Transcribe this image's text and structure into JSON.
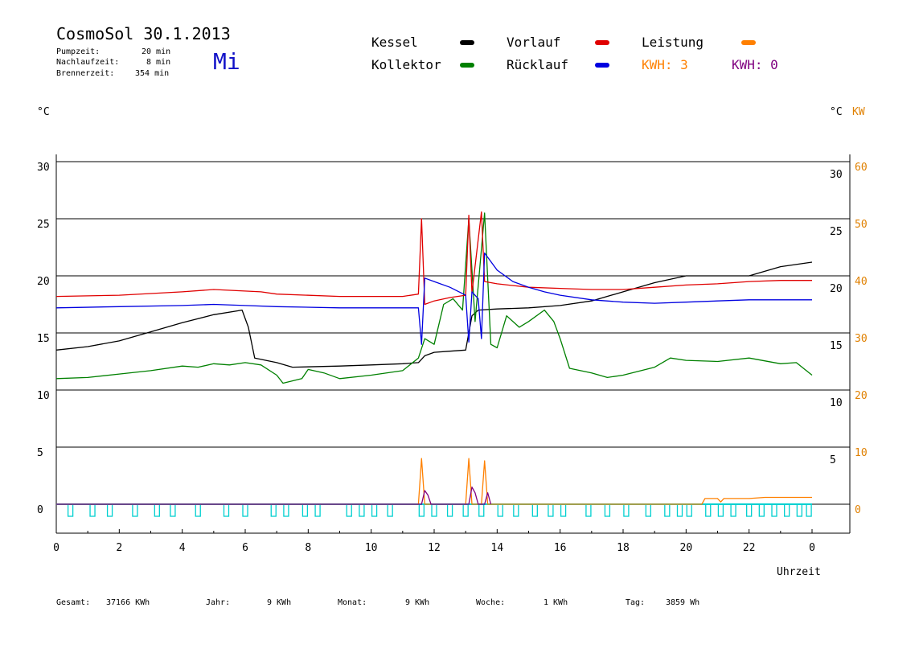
{
  "header": {
    "title": "CosmoSol 30.1.2013",
    "day": "Mi",
    "pumpzeit_label": "Pumpzeit:",
    "pumpzeit_value": "20 min",
    "nachlaufzeit_label": "Nachlaufzeit:",
    "nachlaufzeit_value": "8 min",
    "brennerzeit_label": "Brennerzeit:",
    "brennerzeit_value": "354 min"
  },
  "legend": {
    "kessel": "Kessel",
    "kollektor": "Kollektor",
    "vorlauf": "Vorlauf",
    "ruecklauf": "Rücklauf",
    "leistung": "Leistung",
    "kwh1": "KWH: 3",
    "kwh2": "KWH: 0",
    "colors": {
      "kessel": "#000000",
      "kollektor": "#008000",
      "vorlauf": "#e00000",
      "ruecklauf": "#0000e0",
      "leistung": "#ff8000",
      "kwh2": "#800080",
      "pulse": "#00d0d0"
    }
  },
  "footer": {
    "gesamt_label": "Gesamt:",
    "gesamt_value": "37166 KWh",
    "jahr_label": "Jahr:",
    "jahr_value": "9 KWh",
    "monat_label": "Monat:",
    "monat_value": "9 KWh",
    "woche_label": "Woche:",
    "woche_value": "1 KWh",
    "tag_label": "Tag:",
    "tag_value": "3859 Wh"
  },
  "chart_data": {
    "type": "line",
    "xlabel": "Uhrzeit",
    "ylabel_left": "°C",
    "ylabel_right": "°C",
    "ylabel_right2": "KW",
    "xlim": [
      0,
      24
    ],
    "ylim": [
      -2.5,
      32
    ],
    "x_ticks": [
      "0",
      "2",
      "4",
      "6",
      "8",
      "10",
      "12",
      "14",
      "16",
      "18",
      "20",
      "22",
      "0"
    ],
    "y_ticks_left": [
      "0",
      "5",
      "10",
      "15",
      "20",
      "25",
      "30"
    ],
    "y_ticks_right": [
      "5",
      "10",
      "15",
      "20",
      "25",
      "30"
    ],
    "y_ticks_kw": [
      "0",
      "10",
      "20",
      "30",
      "40",
      "50",
      "60"
    ],
    "grid": true,
    "series": [
      {
        "name": "Kessel",
        "color": "#000000",
        "points": [
          [
            0,
            13.5
          ],
          [
            1,
            13.8
          ],
          [
            2,
            14.3
          ],
          [
            3,
            15.1
          ],
          [
            4,
            15.9
          ],
          [
            5,
            16.6
          ],
          [
            5.9,
            17.0
          ],
          [
            6.1,
            15.5
          ],
          [
            6.3,
            12.8
          ],
          [
            7,
            12.4
          ],
          [
            7.5,
            12.0
          ],
          [
            9,
            12.1
          ],
          [
            10,
            12.2
          ],
          [
            11,
            12.3
          ],
          [
            11.5,
            12.4
          ],
          [
            11.7,
            13.0
          ],
          [
            12,
            13.3
          ],
          [
            12.5,
            13.4
          ],
          [
            13.0,
            13.5
          ],
          [
            13.2,
            16.5
          ],
          [
            13.4,
            17.0
          ],
          [
            14,
            17.1
          ],
          [
            15,
            17.2
          ],
          [
            16,
            17.4
          ],
          [
            17,
            17.8
          ],
          [
            18,
            18.6
          ],
          [
            19,
            19.4
          ],
          [
            20,
            20.0
          ],
          [
            21,
            20.0
          ],
          [
            22,
            20.0
          ],
          [
            23,
            20.8
          ],
          [
            24,
            21.2
          ]
        ]
      },
      {
        "name": "Kollektor",
        "color": "#008000",
        "points": [
          [
            0,
            11.0
          ],
          [
            1,
            11.1
          ],
          [
            2,
            11.4
          ],
          [
            3,
            11.7
          ],
          [
            4,
            12.1
          ],
          [
            4.5,
            12.0
          ],
          [
            5,
            12.3
          ],
          [
            5.5,
            12.2
          ],
          [
            6,
            12.4
          ],
          [
            6.5,
            12.2
          ],
          [
            7,
            11.3
          ],
          [
            7.2,
            10.6
          ],
          [
            7.8,
            11.0
          ],
          [
            8,
            11.8
          ],
          [
            8.5,
            11.5
          ],
          [
            9,
            11.0
          ],
          [
            10,
            11.3
          ],
          [
            11,
            11.7
          ],
          [
            11.5,
            12.8
          ],
          [
            11.7,
            14.5
          ],
          [
            12,
            14.0
          ],
          [
            12.3,
            17.5
          ],
          [
            12.6,
            18.0
          ],
          [
            12.9,
            17.0
          ],
          [
            13.1,
            25.0
          ],
          [
            13.3,
            16.0
          ],
          [
            13.6,
            25.5
          ],
          [
            13.8,
            14.0
          ],
          [
            14,
            13.7
          ],
          [
            14.3,
            16.5
          ],
          [
            14.7,
            15.5
          ],
          [
            15,
            16.0
          ],
          [
            15.5,
            17.0
          ],
          [
            15.8,
            16.0
          ],
          [
            16,
            14.5
          ],
          [
            16.3,
            11.9
          ],
          [
            17,
            11.5
          ],
          [
            17.5,
            11.1
          ],
          [
            18,
            11.3
          ],
          [
            19,
            12.0
          ],
          [
            19.5,
            12.8
          ],
          [
            20,
            12.6
          ],
          [
            21,
            12.5
          ],
          [
            22,
            12.8
          ],
          [
            23,
            12.3
          ],
          [
            23.5,
            12.4
          ],
          [
            24,
            11.3
          ]
        ]
      },
      {
        "name": "Vorlauf",
        "color": "#e00000",
        "points": [
          [
            0,
            18.2
          ],
          [
            2,
            18.3
          ],
          [
            4,
            18.6
          ],
          [
            5,
            18.8
          ],
          [
            6.5,
            18.6
          ],
          [
            7,
            18.4
          ],
          [
            9,
            18.2
          ],
          [
            11,
            18.2
          ],
          [
            11.5,
            18.4
          ],
          [
            11.6,
            25.0
          ],
          [
            11.7,
            17.5
          ],
          [
            12,
            17.8
          ],
          [
            12.5,
            18.1
          ],
          [
            13,
            18.3
          ],
          [
            13.1,
            25.3
          ],
          [
            13.2,
            18.5
          ],
          [
            13.5,
            25.6
          ],
          [
            13.6,
            19.5
          ],
          [
            14,
            19.3
          ],
          [
            15,
            19.0
          ],
          [
            16,
            18.9
          ],
          [
            17,
            18.8
          ],
          [
            18,
            18.8
          ],
          [
            19,
            19.0
          ],
          [
            20,
            19.2
          ],
          [
            21,
            19.3
          ],
          [
            22,
            19.5
          ],
          [
            23,
            19.6
          ],
          [
            24,
            19.6
          ]
        ]
      },
      {
        "name": "Rücklauf",
        "color": "#0000e0",
        "points": [
          [
            0,
            17.2
          ],
          [
            2,
            17.3
          ],
          [
            4,
            17.4
          ],
          [
            5,
            17.5
          ],
          [
            6,
            17.4
          ],
          [
            7,
            17.3
          ],
          [
            9,
            17.2
          ],
          [
            11,
            17.2
          ],
          [
            11.5,
            17.2
          ],
          [
            11.6,
            14.0
          ],
          [
            11.7,
            19.8
          ],
          [
            12,
            19.5
          ],
          [
            12.5,
            19.0
          ],
          [
            13,
            18.3
          ],
          [
            13.1,
            14.2
          ],
          [
            13.2,
            18.6
          ],
          [
            13.4,
            18.0
          ],
          [
            13.5,
            14.5
          ],
          [
            13.6,
            22.0
          ],
          [
            14,
            20.5
          ],
          [
            14.5,
            19.5
          ],
          [
            15,
            19.0
          ],
          [
            15.5,
            18.6
          ],
          [
            16,
            18.3
          ],
          [
            17,
            17.9
          ],
          [
            18,
            17.7
          ],
          [
            19,
            17.6
          ],
          [
            20,
            17.7
          ],
          [
            21,
            17.8
          ],
          [
            22,
            17.9
          ],
          [
            23,
            17.9
          ],
          [
            24,
            17.9
          ]
        ]
      },
      {
        "name": "Leistung",
        "color": "#ff8000",
        "points": [
          [
            0,
            0
          ],
          [
            11.5,
            0
          ],
          [
            11.6,
            4.0
          ],
          [
            11.7,
            0
          ],
          [
            13.0,
            0
          ],
          [
            13.1,
            4.0
          ],
          [
            13.2,
            0
          ],
          [
            13.5,
            0
          ],
          [
            13.6,
            3.8
          ],
          [
            13.7,
            0
          ],
          [
            20.5,
            0
          ],
          [
            20.6,
            0.5
          ],
          [
            21,
            0.5
          ],
          [
            21.1,
            0.2
          ],
          [
            21.2,
            0.5
          ],
          [
            22,
            0.5
          ],
          [
            22.5,
            0.6
          ],
          [
            24,
            0.6
          ]
        ]
      },
      {
        "name": "KWH",
        "color": "#800080",
        "points": [
          [
            0,
            0
          ],
          [
            11.6,
            0
          ],
          [
            11.7,
            1.2
          ],
          [
            11.8,
            0.8
          ],
          [
            11.9,
            0
          ],
          [
            13.1,
            0
          ],
          [
            13.2,
            1.5
          ],
          [
            13.3,
            1.0
          ],
          [
            13.4,
            0
          ],
          [
            13.6,
            0
          ],
          [
            13.7,
            1.0
          ],
          [
            13.8,
            0
          ]
        ]
      }
    ],
    "pulse_times": [
      0.45,
      1.15,
      1.7,
      2.5,
      3.2,
      3.7,
      4.5,
      5.4,
      6.0,
      6.9,
      7.3,
      7.9,
      8.3,
      9.3,
      9.7,
      10.1,
      10.6,
      11.6,
      12.0,
      12.5,
      13.0,
      13.5,
      14.1,
      14.6,
      15.2,
      15.7,
      16.1,
      16.9,
      17.5,
      18.1,
      18.8,
      19.4,
      19.8,
      20.1,
      20.7,
      21.1,
      21.5,
      22.0,
      22.4,
      22.8,
      23.2,
      23.6,
      23.9
    ]
  }
}
